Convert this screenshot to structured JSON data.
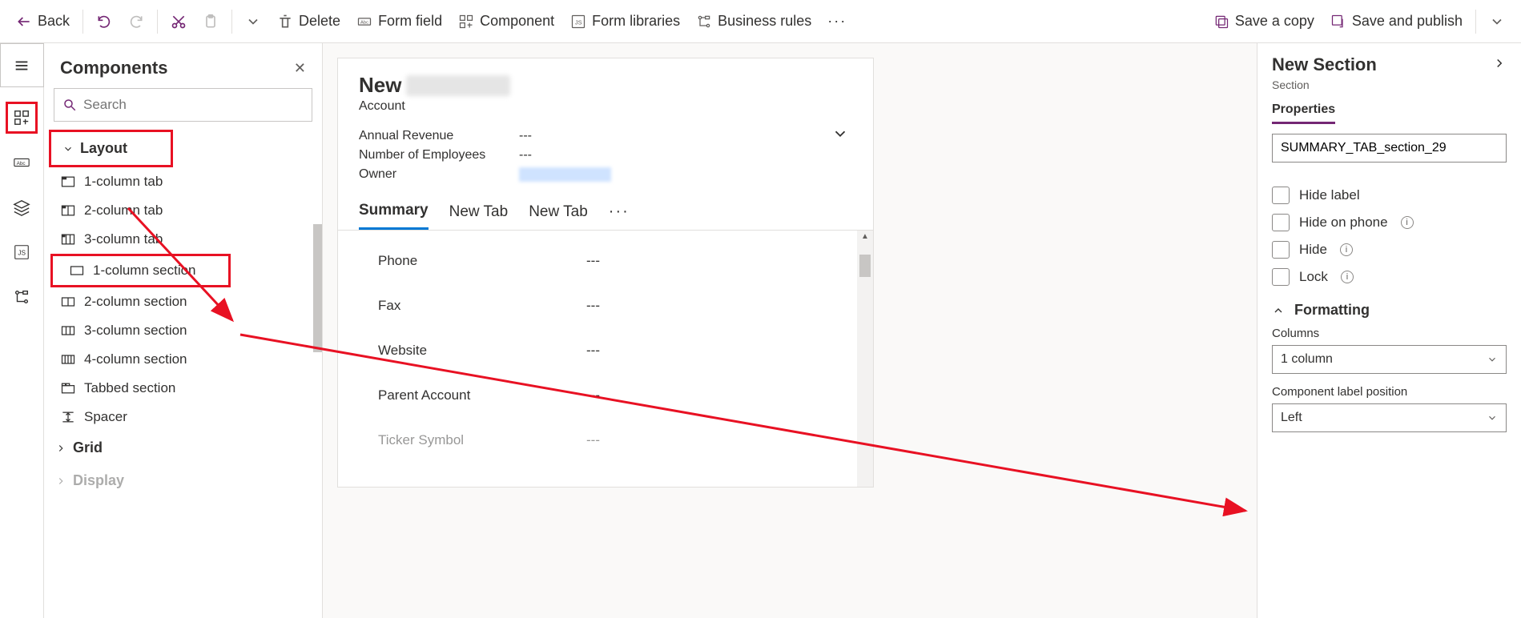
{
  "toolbar": {
    "back": "Back",
    "delete": "Delete",
    "form_field": "Form field",
    "component": "Component",
    "form_libraries": "Form libraries",
    "business_rules": "Business rules",
    "save_copy": "Save a copy",
    "save_publish": "Save and publish"
  },
  "components": {
    "title": "Components",
    "search_placeholder": "Search",
    "groups": {
      "layout": "Layout",
      "grid": "Grid",
      "display": "Display"
    },
    "items": {
      "col1tab": "1-column tab",
      "col2tab": "2-column tab",
      "col3tab": "3-column tab",
      "col1sec": "1-column section",
      "col2sec": "2-column section",
      "col3sec": "3-column section",
      "col4sec": "4-column section",
      "tabbed": "Tabbed section",
      "spacer": "Spacer"
    }
  },
  "form": {
    "title_prefix": "New",
    "entity": "Account",
    "header_fields": {
      "annual_revenue": {
        "k": "Annual Revenue",
        "v": "---"
      },
      "num_employees": {
        "k": "Number of Employees",
        "v": "---"
      },
      "owner": {
        "k": "Owner"
      }
    },
    "tabs": {
      "t1": "Summary",
      "t2": "New Tab",
      "t3": "New Tab"
    },
    "fields": {
      "phone": {
        "k": "Phone",
        "v": "---"
      },
      "fax": {
        "k": "Fax",
        "v": "---"
      },
      "website": {
        "k": "Website",
        "v": "---"
      },
      "parent": {
        "k": "Parent Account",
        "v": "---"
      },
      "ticker": {
        "k": "Ticker Symbol",
        "v": "---"
      }
    }
  },
  "props": {
    "title": "New Section",
    "sub": "Section",
    "tab": "Properties",
    "name_value": "SUMMARY_TAB_section_29",
    "hide_label": "Hide label",
    "hide_phone": "Hide on phone",
    "hide": "Hide",
    "lock": "Lock",
    "formatting": "Formatting",
    "columns_label": "Columns",
    "columns_value": "1 column",
    "label_pos_label": "Component label position",
    "label_pos_value": "Left"
  }
}
